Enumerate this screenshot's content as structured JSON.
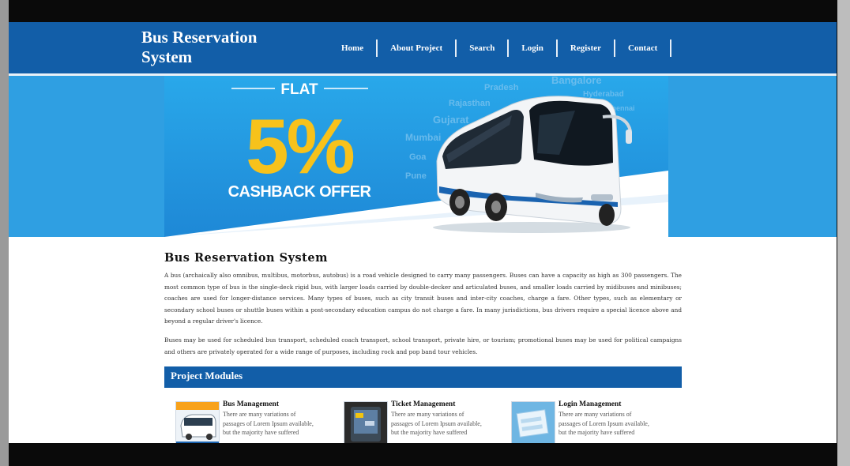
{
  "header": {
    "logo": "Bus Reservation System",
    "nav": [
      "Home",
      "About Project",
      "Search",
      "Login",
      "Register",
      "Contact"
    ]
  },
  "banner": {
    "flat": "FLAT",
    "percent": "5%",
    "offer": "CASHBACK OFFER",
    "cities": [
      "Bangalore",
      "Pradesh",
      "Rajasthan",
      "Gujarat",
      "Mumbai",
      "Goa",
      "Pune",
      "Hyderabad",
      "Chennai"
    ]
  },
  "main": {
    "title": "Bus Reservation System",
    "paragraph1": "A bus (archaically also omnibus, multibus, motorbus, autobus) is a road vehicle designed to carry many passengers. Buses can have a capacity as high as 300 passengers. The most common type of bus is the single-deck rigid bus, with larger loads carried by double-decker and articulated buses, and smaller loads carried by midibuses and minibuses; coaches are used for longer-distance services. Many types of buses, such as city transit buses and inter-city coaches, charge a fare. Other types, such as elementary or secondary school buses or shuttle buses within a post-secondary education campus do not charge a fare. In many jurisdictions, bus drivers require a special licence above and beyond a regular driver's licence.",
    "paragraph2": "Buses may be used for scheduled bus transport, scheduled coach transport, school transport, private hire, or tourism; promotional buses may be used for political campaigns and others are privately operated for a wide range of purposes, including rock and pop band tour vehicles."
  },
  "modules": {
    "heading": "Project Modules",
    "items": [
      {
        "title": "Bus Management",
        "text": "There are many variations of passages of Lorem Ipsum available, but the majority have suffered"
      },
      {
        "title": "Ticket Management",
        "text": "There are many variations of passages of Lorem Ipsum available, but the majority have suffered"
      },
      {
        "title": "Login Management",
        "text": "There are many variations of passages of Lorem Ipsum available, but the majority have suffered"
      }
    ]
  },
  "colors": {
    "header": "#125ea8",
    "banner_band": "#2f9fe2",
    "offer_yellow": "#f7c21b"
  }
}
